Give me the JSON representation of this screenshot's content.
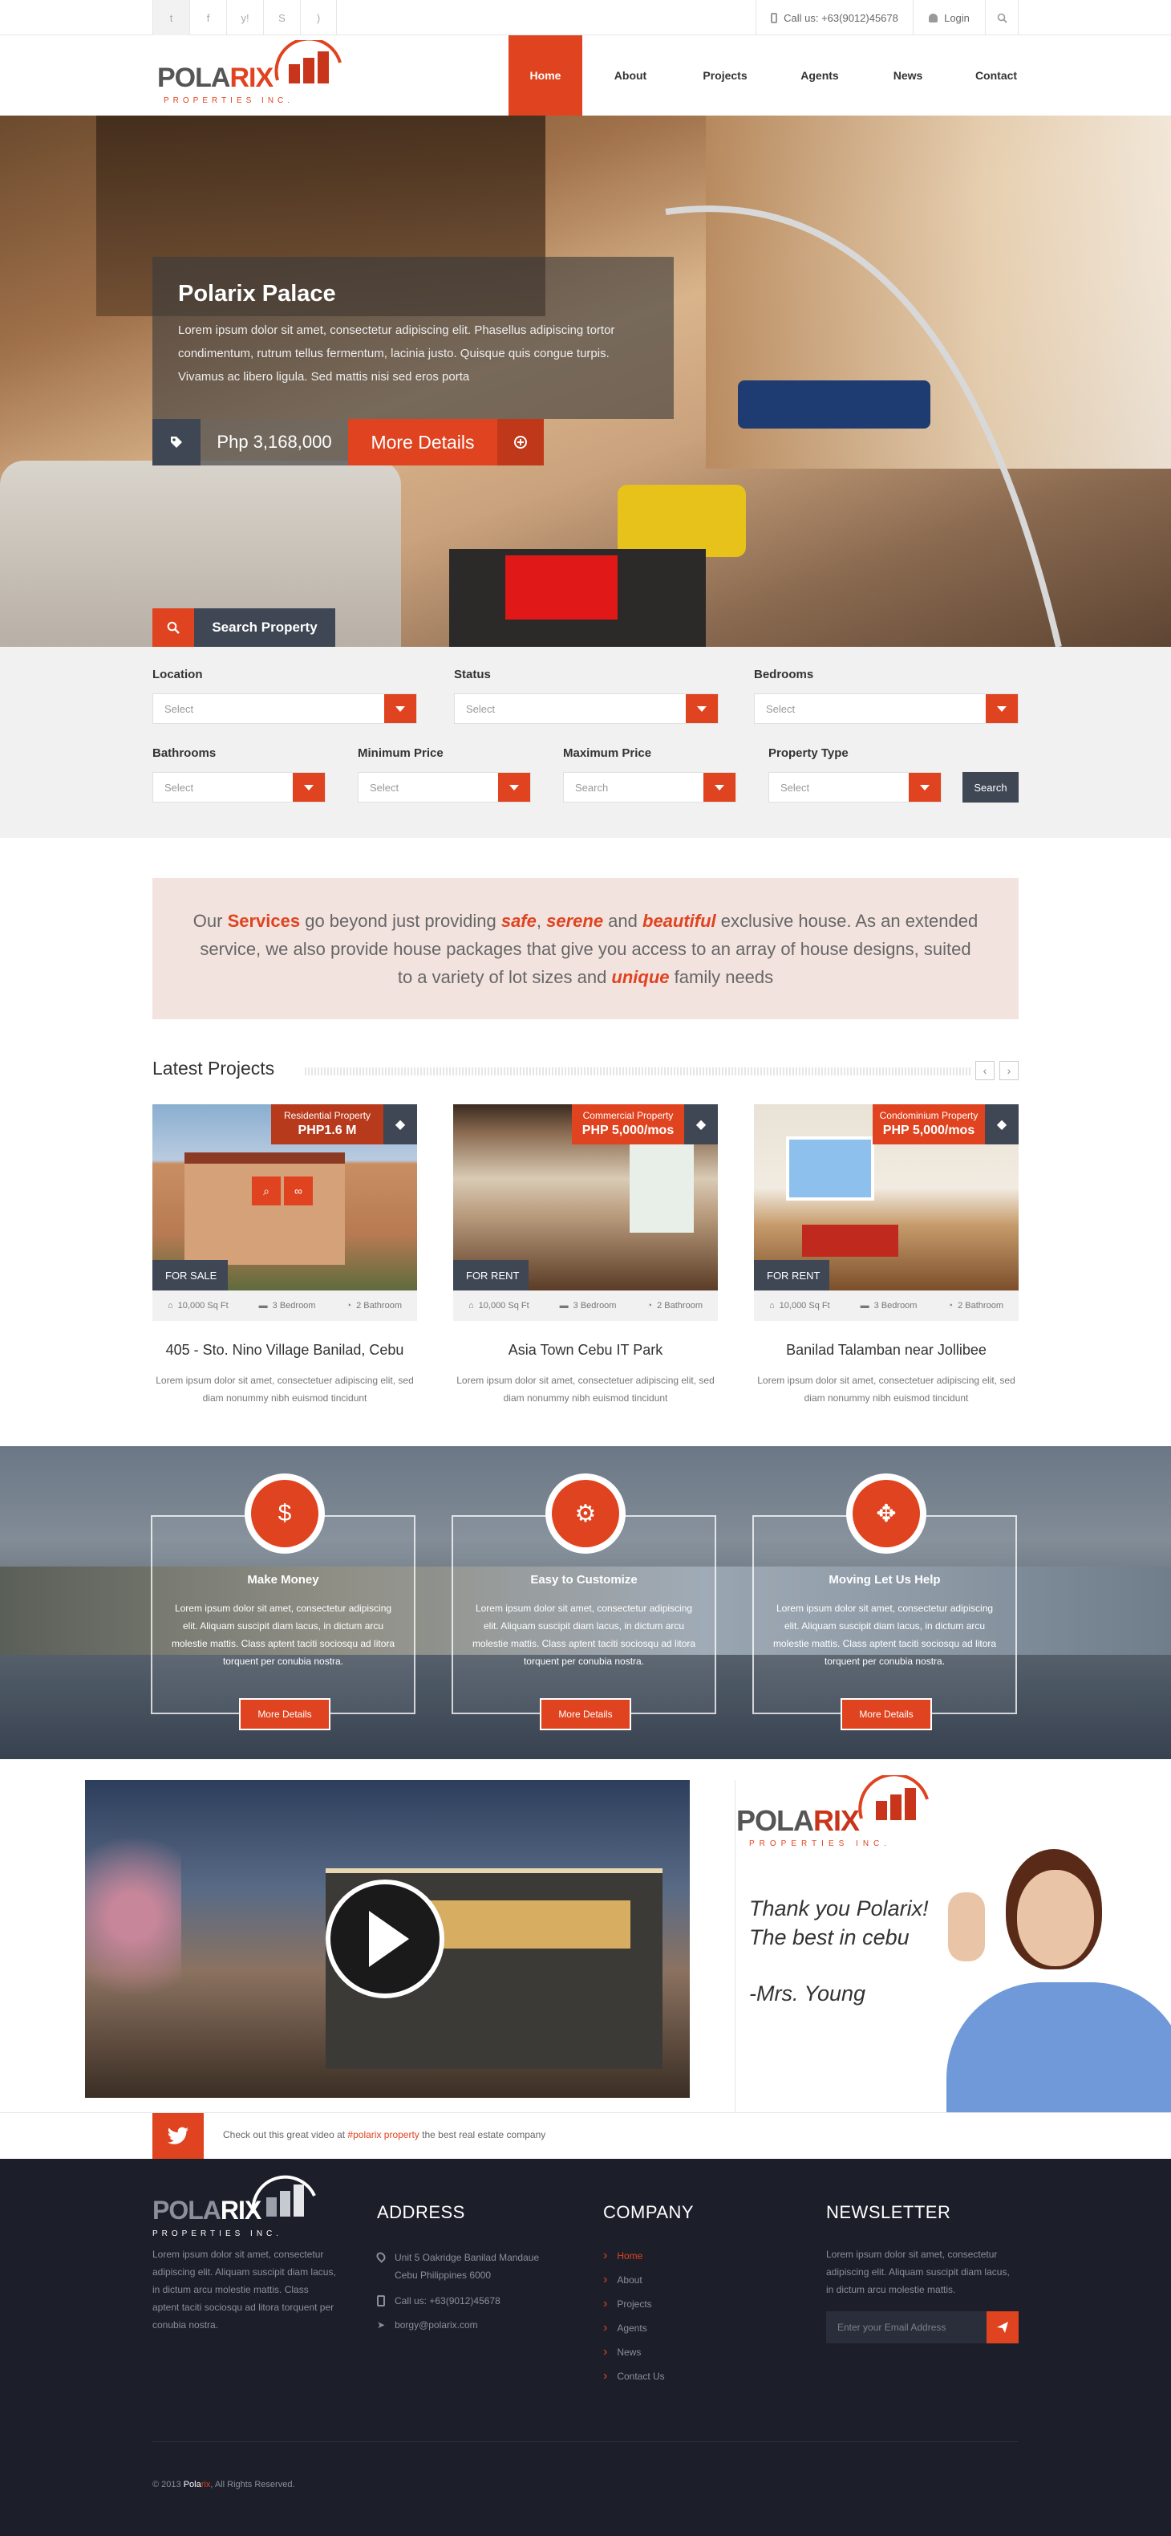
{
  "colors": {
    "accent": "#e0431f",
    "dark": "#3f4654",
    "footer": "#1c1f2a",
    "panel": "#f1f1f1"
  },
  "topbar": {
    "social": [
      "twitter-icon",
      "facebook-icon",
      "yahoo-icon",
      "skype-icon",
      "rss-icon"
    ],
    "call": "Call us: +63(9012)45678",
    "login": "Login"
  },
  "brand": {
    "name_dark": "POLA",
    "name_red": "RIX",
    "tagline": "PROPERTIES INC."
  },
  "nav": [
    "Home",
    "About",
    "Projects",
    "Agents",
    "News",
    "Contact"
  ],
  "hero": {
    "title": "Polarix Palace",
    "text": "Lorem ipsum dolor sit amet, consectetur adipiscing elit. Phasellus adipiscing tortor condimentum, rutrum tellus fermentum, lacinia justo. Quisque quis congue turpis. Vivamus ac libero ligula. Sed mattis nisi sed eros porta",
    "price": "Php 3,168,000",
    "details": "More Details"
  },
  "search": {
    "tab": "Search Property",
    "location": "Location",
    "status": "Status",
    "bedrooms": "Bedrooms",
    "bathrooms": "Bathrooms",
    "min_price": "Minimum Price",
    "max_price": "Maximum Price",
    "property_type": "Property Type",
    "select": "Select",
    "search_placeholder": "Search",
    "button": "Search"
  },
  "intro": {
    "p1": "Our ",
    "w1": "Services",
    "p2": " go beyond just providing ",
    "w2": "safe",
    "p3": ", ",
    "w3": "serene",
    "p4": " and ",
    "w4": "beautiful",
    "p5": " exclusive house. As an extended service, we also provide house packages that give you access to an array of house designs, suited to a variety of lot sizes and ",
    "w5": "unique",
    "p6": " family needs"
  },
  "latest": {
    "heading": "Latest Projects",
    "projects": [
      {
        "type": "Residential Property",
        "price": "PHP1.6 M",
        "status": "FOR SALE",
        "area": "10,000 Sq Ft",
        "bed": "3 Bedroom",
        "bath": "2 Bathroom",
        "title": "405 - Sto. Nino Village Banilad, Cebu",
        "desc": "Lorem ipsum dolor sit amet, consectetuer adipiscing elit, sed diam nonummy nibh euismod tincidunt"
      },
      {
        "type": "Commercial Property",
        "price": "PHP 5,000/mos",
        "status": "FOR RENT",
        "area": "10,000 Sq Ft",
        "bed": "3 Bedroom",
        "bath": "2 Bathroom",
        "title": "Asia Town Cebu IT Park",
        "desc": "Lorem ipsum dolor sit amet, consectetuer adipiscing elit, sed diam nonummy nibh euismod tincidunt"
      },
      {
        "type": "Condominium Property",
        "price": "PHP 5,000/mos",
        "status": "FOR RENT",
        "area": "10,000 Sq Ft",
        "bed": "3 Bedroom",
        "bath": "2 Bathroom",
        "title": "Banilad Talamban near Jollibee",
        "desc": "Lorem ipsum dolor sit amet, consectetuer adipiscing elit, sed diam nonummy nibh euismod tincidunt"
      }
    ]
  },
  "services": [
    {
      "title": "Make Money",
      "icon": "money-tag-icon",
      "text": "Lorem ipsum dolor sit amet, consectetur adipiscing elit. Aliquam suscipit diam lacus, in dictum arcu molestie mattis. Class aptent taciti sociosqu ad litora torquent per conubia nostra.",
      "button": "More Details"
    },
    {
      "title": "Easy to Customize",
      "icon": "gears-icon",
      "text": "Lorem ipsum dolor sit amet, consectetur adipiscing elit. Aliquam suscipit diam lacus, in dictum arcu molestie mattis. Class aptent taciti sociosqu ad litora torquent per conubia nostra.",
      "button": "More Details"
    },
    {
      "title": "Moving Let Us Help",
      "icon": "move-arrows-icon",
      "text": "Lorem ipsum dolor sit amet, consectetur adipiscing elit. Aliquam suscipit diam lacus, in dictum arcu molestie mattis. Class aptent taciti sociosqu ad litora torquent per conubia nostra.",
      "button": "More Details"
    }
  ],
  "testimonial": {
    "l1": "Thank you Polarix!",
    "l2": "The best in  cebu",
    "l3": "-Mrs. Young"
  },
  "tweet": {
    "pre": "Check out this great video at ",
    "tag": "#polarix property",
    "post": " the best real estate company"
  },
  "footer": {
    "about": "Lorem ipsum dolor sit amet, consectetur adipiscing elit. Aliquam suscipit diam lacus, in dictum arcu molestie mattis. Class aptent taciti sociosqu ad litora torquent per conubia nostra.",
    "address_h": "ADDRESS",
    "addr1": "Unit 5 Oakridge Banilad Mandaue",
    "addr2": "Cebu Philippines 6000",
    "phone": "Call us: +63(9012)45678",
    "email": "borgy@polarix.com",
    "company_h": "COMPANY",
    "company": [
      "Home",
      "About",
      "Projects",
      "Agents",
      "News",
      "Contact Us"
    ],
    "news_h": "NEWSLETTER",
    "news_text": "Lorem ipsum dolor sit amet, consectetur adipiscing elit. Aliquam suscipit diam lacus, in dictum arcu molestie mattis.",
    "email_placeholder": "Enter your Email Address",
    "copy_pre": "© 2013 ",
    "copy_a": "Pola",
    "copy_b": "rix",
    "copy_post": ", All Rights Reserved."
  }
}
